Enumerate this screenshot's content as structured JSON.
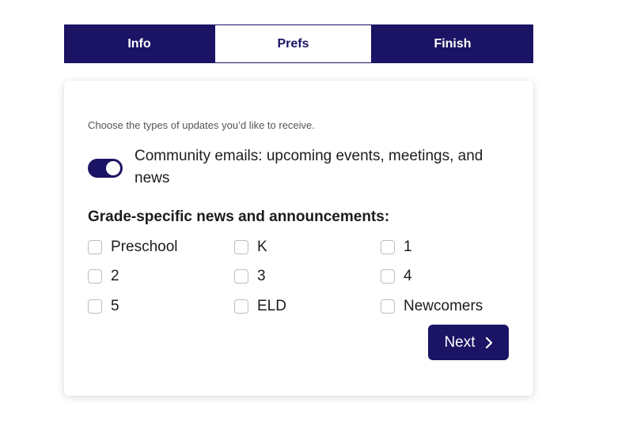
{
  "tabs": [
    {
      "label": "Info"
    },
    {
      "label": "Prefs",
      "active": true
    },
    {
      "label": "Finish"
    }
  ],
  "form": {
    "intro": "Choose the types of updates you’d like to receive.",
    "toggle": {
      "label": "Community emails: upcoming events, meetings, and news",
      "on": true
    },
    "section_title": "Grade-specific news and announcements:",
    "checkboxes": [
      {
        "label": "Preschool",
        "checked": false
      },
      {
        "label": "K",
        "checked": false
      },
      {
        "label": "1",
        "checked": false
      },
      {
        "label": "2",
        "checked": false
      },
      {
        "label": "3",
        "checked": false
      },
      {
        "label": "4",
        "checked": false
      },
      {
        "label": "5",
        "checked": false
      },
      {
        "label": "ELD",
        "checked": false
      },
      {
        "label": "Newcomers",
        "checked": false
      }
    ],
    "next_label": "Next",
    "next_icon": "chevron-right-icon"
  },
  "colors": {
    "primary": "#1b1464",
    "checkbox_border": "#bdbdbd",
    "muted_text": "#555555"
  }
}
